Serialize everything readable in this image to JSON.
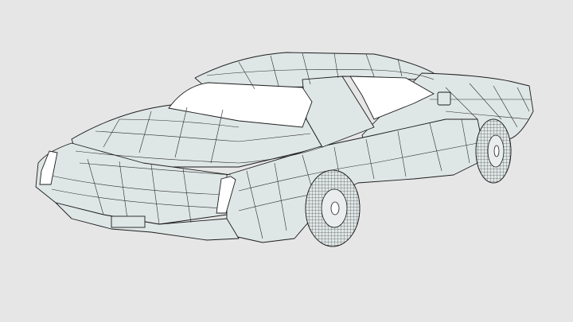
{
  "scene": {
    "subject": "car-wireframe-render",
    "colors": {
      "background": "#e6e6e6",
      "body_fill": "#dfe6e6",
      "glass_fill": "#ffffff",
      "line": "#1c1c1c"
    }
  }
}
